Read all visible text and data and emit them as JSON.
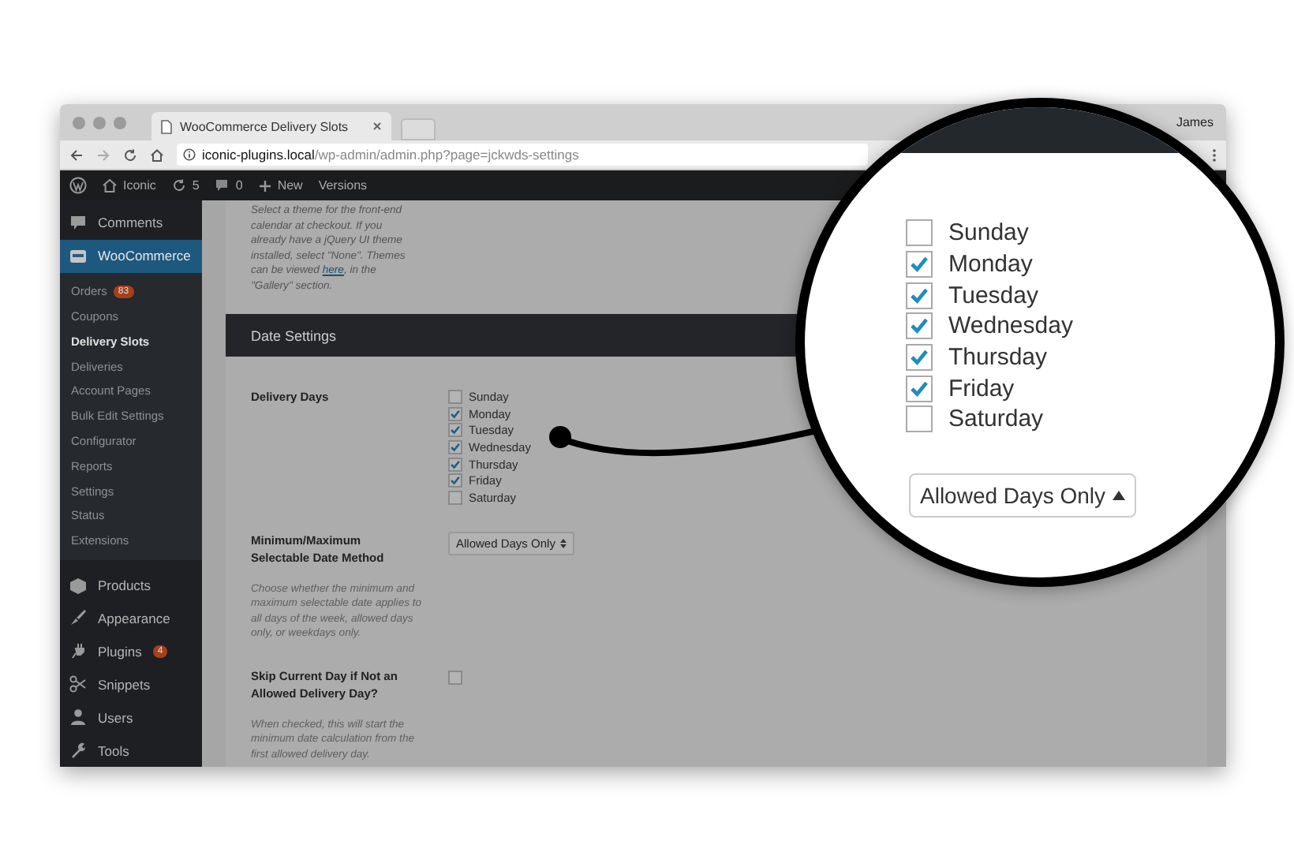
{
  "browser": {
    "tab_title": "WooCommerce Delivery Slots",
    "profile": "James",
    "url_host": "iconic-plugins.local",
    "url_path": "/wp-admin/admin.php?page=jckwds-settings"
  },
  "admin_bar": {
    "site": "Iconic",
    "updates": "5",
    "comments": "0",
    "new": "New",
    "versions": "Versions"
  },
  "sidebar": {
    "items": [
      {
        "label": "Comments",
        "selected": false
      },
      {
        "label": "WooCommerce",
        "selected": true,
        "children": [
          {
            "label": "Orders",
            "badge": "83",
            "selected": false
          },
          {
            "label": "Coupons",
            "selected": false
          },
          {
            "label": "Delivery Slots",
            "selected": true
          },
          {
            "label": "Deliveries",
            "selected": false
          },
          {
            "label": "Account Pages",
            "selected": false
          },
          {
            "label": "Bulk Edit Settings",
            "selected": false
          },
          {
            "label": "Configurator",
            "selected": false
          },
          {
            "label": "Reports",
            "selected": false
          },
          {
            "label": "Settings",
            "selected": false
          },
          {
            "label": "Status",
            "selected": false
          },
          {
            "label": "Extensions",
            "selected": false
          }
        ]
      },
      {
        "label": "Products",
        "selected": false
      },
      {
        "label": "Appearance",
        "selected": false
      },
      {
        "label": "Plugins",
        "badge": "4",
        "selected": false
      },
      {
        "label": "Snippets",
        "selected": false
      },
      {
        "label": "Users",
        "selected": false
      },
      {
        "label": "Tools",
        "selected": false
      }
    ]
  },
  "content": {
    "theme_help": {
      "before": "Select a theme for the front-end calendar at checkout. If you already have a jQuery UI theme installed, select \"None\". Themes can be viewed",
      "link": "here",
      "after": ", in the \"Gallery\" section."
    },
    "section_title": "Date Settings",
    "fields": [
      {
        "kind": "checklist",
        "label": "Delivery Days",
        "options": [
          {
            "label": "Sunday",
            "checked": false
          },
          {
            "label": "Monday",
            "checked": true
          },
          {
            "label": "Tuesday",
            "checked": true
          },
          {
            "label": "Wednesday",
            "checked": true
          },
          {
            "label": "Thursday",
            "checked": true
          },
          {
            "label": "Friday",
            "checked": true
          },
          {
            "label": "Saturday",
            "checked": false
          }
        ]
      },
      {
        "kind": "select",
        "label": "Minimum/Maximum Selectable Date Method",
        "value": "Allowed Days Only",
        "description": "Choose whether the minimum and maximum selectable date applies to all days of the week, allowed days only, or weekdays only."
      },
      {
        "kind": "checkbox",
        "label": "Skip Current Day if Not an Allowed Delivery Day?",
        "checked": false,
        "description": "When checked, this will start the minimum date calculation from the first *allowed* delivery day."
      }
    ]
  },
  "magnifier": {
    "options": [
      {
        "label": "Sunday",
        "checked": false
      },
      {
        "label": "Monday",
        "checked": true
      },
      {
        "label": "Tuesday",
        "checked": true
      },
      {
        "label": "Wednesday",
        "checked": true
      },
      {
        "label": "Thursday",
        "checked": true
      },
      {
        "label": "Friday",
        "checked": true
      },
      {
        "label": "Saturday",
        "checked": false
      }
    ],
    "select_value": "Allowed Days Only"
  }
}
